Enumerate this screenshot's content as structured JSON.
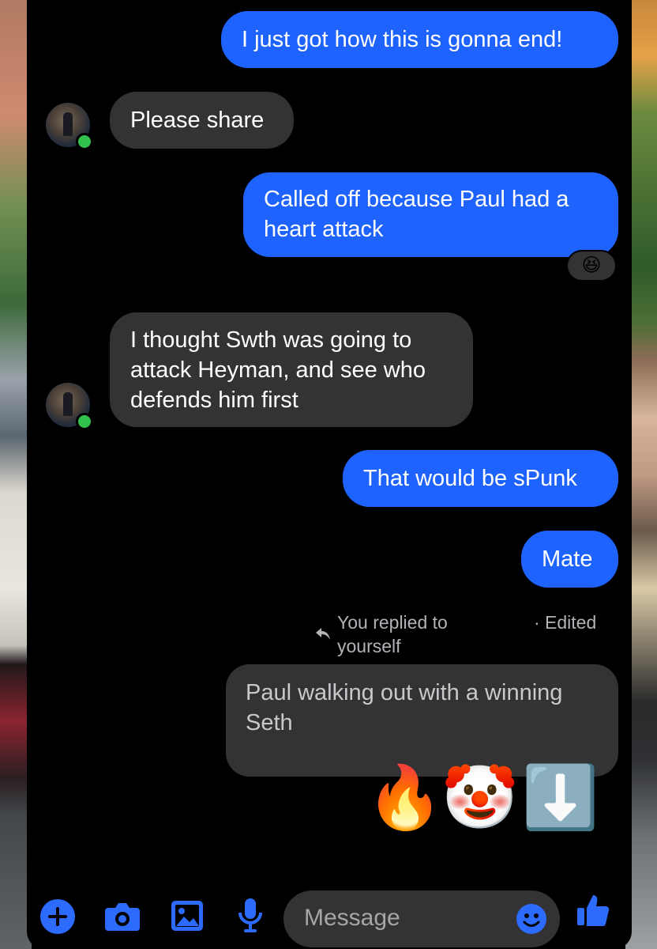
{
  "messages": [
    {
      "id": "m1",
      "direction": "outgoing",
      "text": "I just got how this is gonna end!"
    },
    {
      "id": "m2",
      "direction": "incoming",
      "text": "Please share"
    },
    {
      "id": "m3",
      "direction": "outgoing",
      "lines": [
        "Called off because Paul had a",
        "heart attack"
      ],
      "reaction": "😆"
    },
    {
      "id": "m4",
      "direction": "incoming",
      "lines": [
        "I thought Swth was going to",
        "attack Heyman, and see who",
        "defends him first"
      ]
    },
    {
      "id": "m5",
      "direction": "outgoing",
      "text": "That would be sPunk"
    },
    {
      "id": "m6",
      "direction": "outgoing",
      "text": "Mate"
    }
  ],
  "reply": {
    "context_lines": [
      "You replied to",
      "yourself"
    ],
    "edited_label": "· Edited",
    "quoted_lines": [
      "Paul walking out with a winning",
      "Seth"
    ]
  },
  "big_emojis": [
    "🔥",
    "🤡",
    "⬇️"
  ],
  "composer": {
    "placeholder": "Message",
    "icons": [
      "plus-icon",
      "camera-icon",
      "image-icon",
      "microphone-icon",
      "emoji-icon",
      "like-icon"
    ]
  },
  "colors": {
    "outgoing_bubble": "#1f63ff",
    "incoming_bubble": "#333335",
    "accent": "#2d6bff",
    "online": "#31c24d"
  }
}
